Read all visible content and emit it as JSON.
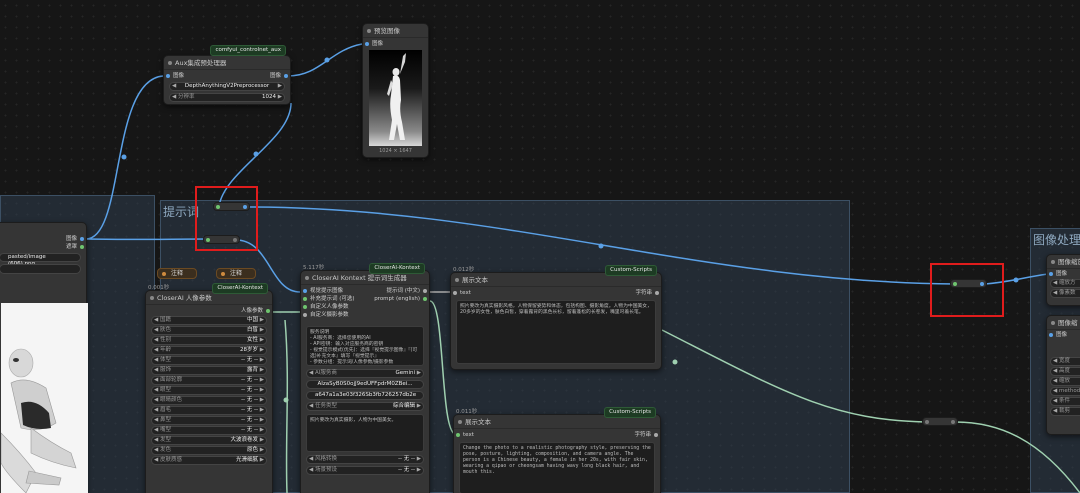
{
  "groups": {
    "prompt_group_title": "提示词",
    "image_group_title": "图像处理"
  },
  "aux_node": {
    "badge": "comfyui_controlnet_aux",
    "title": "Aux集成预处理器",
    "input_image": "图像",
    "output_image": "图像",
    "preprocessor_value": "DepthAnythingV2Preprocessor",
    "resolution_label": "分辨率",
    "resolution_value": "1024"
  },
  "preview_node": {
    "title": "预览图像",
    "input_image": "图像",
    "image_caption": "1024 × 1647"
  },
  "load_image_node": {
    "output_image": "图像",
    "output_mask": "遮罩",
    "filename": "pasted/image (606).png"
  },
  "notes": {
    "note1": "注释",
    "note2": "注释"
  },
  "persona_node": {
    "timer": "0.001秒",
    "badge": "CloserAI-Kontext",
    "title": "CloserAI 人像参数",
    "output_label": "人像参数",
    "params": [
      {
        "label": "国籍",
        "value": "中国"
      },
      {
        "label": "肤色",
        "value": "白皙"
      },
      {
        "label": "性别",
        "value": "女性"
      },
      {
        "label": "年龄",
        "value": "28岁岁"
      },
      {
        "label": "体型",
        "value": "-- 无 --"
      },
      {
        "label": "服饰",
        "value": "露背"
      },
      {
        "label": "面部轮廓",
        "value": "-- 无 --"
      },
      {
        "label": "眼型",
        "value": "-- 无 --"
      },
      {
        "label": "眼睛颜色",
        "value": "-- 无 --"
      },
      {
        "label": "眉毛",
        "value": "-- 无 --"
      },
      {
        "label": "鼻型",
        "value": "-- 无 --"
      },
      {
        "label": "嘴型",
        "value": "-- 无 --"
      },
      {
        "label": "发型",
        "value": "大波浪卷发"
      },
      {
        "label": "发色",
        "value": "原色"
      },
      {
        "label": "皮肤质感",
        "value": "光滑细腻"
      }
    ]
  },
  "kontext_node": {
    "timer": "5.117秒",
    "badge": "CloserAI-Kontext",
    "title": "CloserAI Kontext 提示词生成器",
    "inputs": [
      "视觉提示图像",
      "补充提示词 (可选)",
      "自定义人像参数",
      "自定义摄影参数"
    ],
    "outputs": [
      "提示词 (中文)",
      "prompt (english)"
    ],
    "instructions": "服务说明\n- AI服务商：选择您使用的AI\n- API密钥：输入对应服务商的密钥\n- 视觉提示模式(优先)：选择『视觉提示图像』『(可选)补充文本』填写『视觉提示』\n- 参数分组：提示词/人像参数/摄影参数\n- 参数分组模式，若开『视觉提示图像』，使用方为的参数前置。",
    "service_label": "AI服务商",
    "service_value": "Gemini",
    "api_key": "AIzaSyB0S0ojJ9edUFFpdrM0ZBei...",
    "hash_value": "a647a1a3e03f326Sb3fb726257db2e",
    "task_label": "任务类型",
    "task_value": "综合编辑",
    "extra_text": "照片要改为真实摄影，人物为中国美女。",
    "style_label": "风格转换",
    "style_value": "-- 无 --",
    "scene_label": "场景预设",
    "scene_value": "-- 无 --"
  },
  "show_text_1": {
    "timer": "0.012秒",
    "badge": "Custom-Scripts",
    "title": "展示文本",
    "input_label": "text",
    "output_label": "字符串",
    "text": "照片要改为真实摄影风格，人物保留姿势和体态，包括构图、摄影角度。人物为中国美女，20多岁的女性，肤色白皙，穿着露背的黑色长衫，留着蓬松的长卷发，嘴里叼着长笔。"
  },
  "show_text_2": {
    "timer": "0.011秒",
    "badge": "Custom-Scripts",
    "title": "展示文本",
    "input_label": "text",
    "output_label": "字符串",
    "text": "Change the photo to a realistic photography style, preserving the pose, posture, lighting, composition, and camera angle. The person is a Chinese beauty, a female in her 20s, with fair skin, wearing a qipao or cheongsam having wavy long black hair, and mouth this."
  },
  "right_nodes": {
    "node_a_title": "图像缩放",
    "node_a_input": "图像",
    "node_a_w1": "缩放方",
    "node_a_w2": "像素数",
    "node_b_title": "图像缩",
    "node_b_input": "图像",
    "node_b_items": [
      "宽度",
      "高度",
      "缩放",
      "method",
      "条件",
      "裁剪"
    ]
  },
  "colors": {
    "image_wire": "#5aa0e6",
    "string_wire": "#9fd0b0",
    "highlight": "#e01c1c",
    "group_bg": "#303e4e"
  }
}
